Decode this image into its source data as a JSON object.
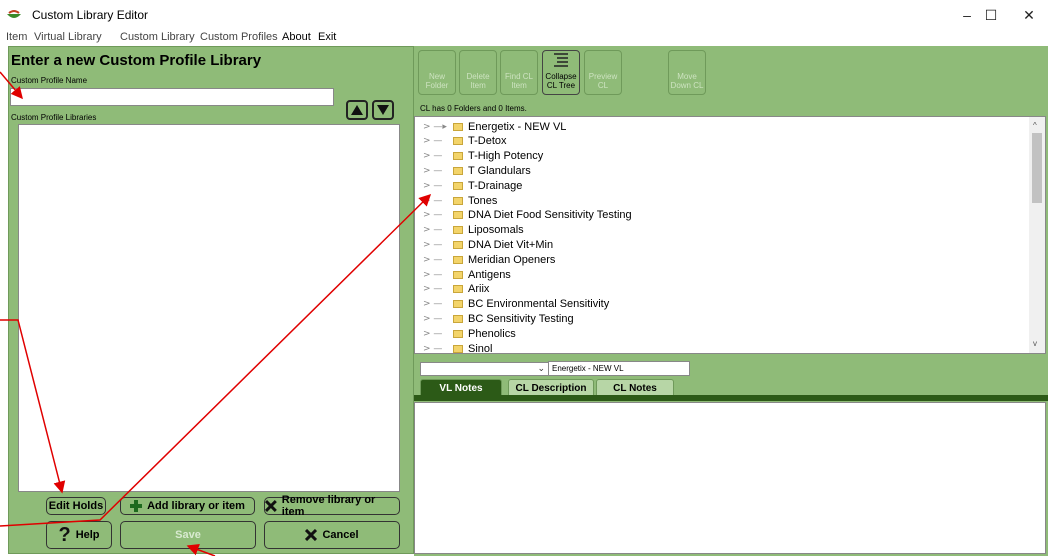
{
  "window": {
    "title": "Custom Library Editor",
    "minimize": "–",
    "maximize": "☐",
    "close": "✕"
  },
  "menu": {
    "item": "Item",
    "virtual_library": "Virtual Library",
    "custom_library": "Custom Library",
    "custom_profiles": "Custom Profiles",
    "about": "About",
    "exit": "Exit"
  },
  "left": {
    "heading": "Enter a new Custom Profile Library",
    "name_label": "Custom Profile Name",
    "name_value": "",
    "libraries_label": "Custom Profile Libraries",
    "edit_holds": "Edit Holds",
    "add": "Add library or item",
    "remove": "Remove library or item",
    "help": "Help",
    "save": "Save",
    "cancel": "Cancel"
  },
  "toolbar": {
    "new_folder": "New Folder",
    "delete_item": "Delete Item",
    "find_cl_item": "Find CL Item",
    "collapse_cl_tree": "Collapse CL Tree",
    "preview_cl": "Preview CL",
    "move_down_cl": "Move Down CL"
  },
  "tree": {
    "status": "CL has 0 Folders and 0 Items.",
    "items": [
      "Energetix - NEW VL",
      "T-Detox",
      "T-High Potency",
      "T Glandulars",
      "T-Drainage",
      "Tones",
      "DNA Diet Food Sensitivity Testing",
      "Liposomals",
      "DNA Diet Vit+Min",
      "Meridian Openers",
      "Antigens",
      "Ariix",
      "BC Environmental Sensitivity",
      "BC Sensitivity Testing",
      "Phenolics",
      "Sinol"
    ]
  },
  "notes": {
    "combo_value": "",
    "vl_name": "Energetix - NEW VL",
    "tabs": [
      "VL Notes",
      "CL Description",
      "CL Notes"
    ]
  },
  "colors": {
    "panel_green": "#8fbb78",
    "dark_green": "#2c5a17",
    "annotation_red": "#e00000"
  }
}
